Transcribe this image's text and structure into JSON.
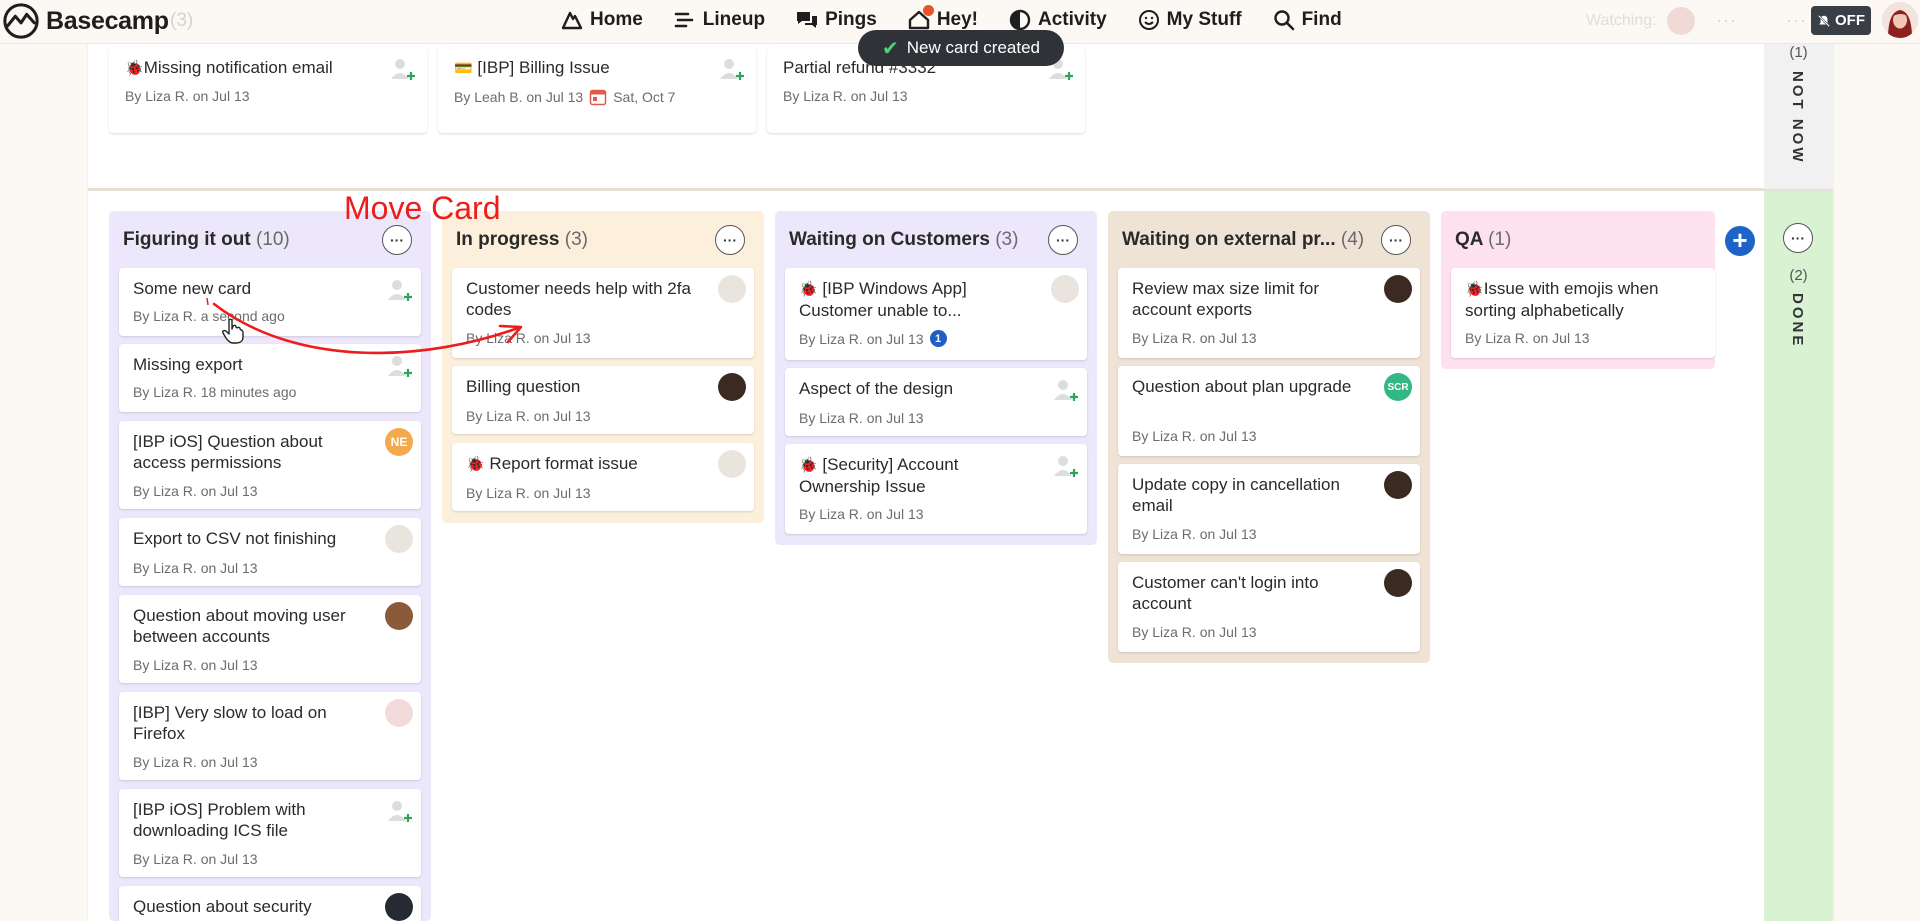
{
  "app": {
    "name": "Basecamp",
    "ghost_count": "(3)"
  },
  "nav": {
    "home": "Home",
    "lineup": "Lineup",
    "pings": "Pings",
    "hey": "Hey!",
    "activity": "Activity",
    "mystuff": "My Stuff",
    "find": "Find"
  },
  "header_right": {
    "watching": "Watching:",
    "dots": "···",
    "off": "OFF"
  },
  "toast": {
    "text": "New card created"
  },
  "annotation": {
    "text": "Move Card",
    "color": "#ee1d1d"
  },
  "top_cards": [
    {
      "title": "Missing notification email",
      "meta": "By Liza R. on Jul 13",
      "icon": "bug-icon"
    },
    {
      "title": "[IBP] Billing Issue",
      "meta": "By Leah B. on Jul 13",
      "due": "Sat, Oct 7",
      "icon": "credit-card-icon"
    },
    {
      "title": "Partial refund #3332",
      "meta": "By Liza R. on Jul 13"
    }
  ],
  "side": {
    "not_now": {
      "count": "(1)",
      "label": "NOT NOW"
    },
    "done": {
      "count": "(2)",
      "label": "DONE"
    },
    "menu": "···"
  },
  "columns": [
    {
      "title": "Figuring it out",
      "count": "(10)",
      "color": "#ece7fb",
      "cards": [
        {
          "title": "Some new card",
          "meta": "By Liza R. a second ago"
        },
        {
          "title": "Missing export",
          "meta": "By Liza R. 18 minutes ago"
        },
        {
          "title": "[IBP iOS] Question about access permissions",
          "meta": "By Liza R. on Jul 13",
          "avatar": "NE"
        },
        {
          "title": "Export to CSV not finishing",
          "meta": "By Liza R. on Jul 13"
        },
        {
          "title": "Question about moving user between accounts",
          "meta": "By Liza R. on Jul 13"
        },
        {
          "title": "[IBP] Very slow to load on Firefox",
          "meta": "By Liza R. on Jul 13"
        },
        {
          "title": "[IBP iOS] Problem with downloading ICS file",
          "meta": "By Liza R. on Jul 13"
        },
        {
          "title": "Question about security",
          "meta": ""
        }
      ]
    },
    {
      "title": "In progress",
      "count": "(3)",
      "color": "#fcefdc",
      "cards": [
        {
          "title": "Customer needs help with 2fa codes",
          "meta": "By Liza R. on Jul 13"
        },
        {
          "title": "Billing question",
          "meta": "By Liza R. on Jul 13"
        },
        {
          "title": "Report format issue",
          "meta": "By Liza R. on Jul 13"
        }
      ]
    },
    {
      "title": "Waiting on Customers",
      "count": "(3)",
      "color": "#ece7fb",
      "cards": [
        {
          "title": "[IBP Windows App] Customer unable to...",
          "meta": "By Liza R. on Jul 13",
          "badge": "1"
        },
        {
          "title": "Aspect of the design",
          "meta": "By Liza R. on Jul 13"
        },
        {
          "title": "[Security] Account Ownership Issue",
          "meta": "By Liza R. on Jul 13"
        }
      ]
    },
    {
      "title": "Waiting on external pr...",
      "count": "(4)",
      "color": "#efe3d6",
      "cards": [
        {
          "title": "Review max size limit for account exports",
          "meta": "By Liza R. on Jul 13"
        },
        {
          "title": "Question about plan upgrade",
          "meta": "By Liza R. on Jul 13",
          "avatar": "SCR"
        },
        {
          "title": "Update copy in cancellation email",
          "meta": "By Liza R. on Jul 13"
        },
        {
          "title": "Customer can't login into account",
          "meta": "By Liza R. on Jul 13"
        }
      ]
    },
    {
      "title": "QA",
      "count": "(1)",
      "color": "#fde1ef",
      "cards": [
        {
          "title": "Issue with emojis when sorting alphabetically",
          "meta": "By Liza R. on Jul 13"
        }
      ]
    }
  ],
  "column_menu": "···",
  "add_column": "+"
}
